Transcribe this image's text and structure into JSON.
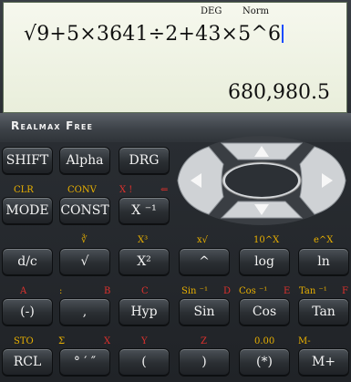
{
  "display": {
    "mode_deg": "DEG",
    "mode_norm": "Norm",
    "expression": "√9+5×3641÷2+43×5^6",
    "result": "680,980.5"
  },
  "app": {
    "name": "Realmax Free"
  },
  "rows": [
    {
      "keys": [
        {
          "id": "shift",
          "label": "SHIFT"
        },
        {
          "id": "alpha",
          "label": "Alpha"
        },
        {
          "id": "drg",
          "label": "DRG"
        }
      ]
    },
    {
      "keys": [
        {
          "id": "mode",
          "label": "MODE",
          "sub_y": "CLR"
        },
        {
          "id": "const",
          "label": "CONST",
          "sub_y": "CONV"
        },
        {
          "id": "recip",
          "label": "X ⁻¹",
          "sub_y": "X !",
          "sub_r": "⇐"
        }
      ]
    },
    {
      "keys": [
        {
          "id": "dc",
          "label": "d/c"
        },
        {
          "id": "sqrt",
          "label": "√",
          "sub_y": "∛"
        },
        {
          "id": "sq",
          "label": "X²",
          "sub_y": "X³"
        },
        {
          "id": "pow",
          "label": "^",
          "sub_y": "x√"
        },
        {
          "id": "log",
          "label": "log",
          "sub_y": "10^X"
        },
        {
          "id": "ln",
          "label": "ln",
          "sub_y": "e^X"
        }
      ]
    },
    {
      "keys": [
        {
          "id": "neg",
          "label": "(-)",
          "sub_r": "A"
        },
        {
          "id": "comma",
          "label": ",",
          "sub_y": ":",
          "sub_r": "B"
        },
        {
          "id": "hyp",
          "label": "Hyp",
          "sub_r": "C"
        },
        {
          "id": "sin",
          "label": "Sin",
          "sub_y": "Sin ⁻¹",
          "sub_r": "D"
        },
        {
          "id": "cos",
          "label": "Cos",
          "sub_y": "Cos ⁻¹",
          "sub_r": "E"
        },
        {
          "id": "tan",
          "label": "Tan",
          "sub_y": "Tan ⁻¹",
          "sub_r": "F"
        }
      ]
    },
    {
      "keys": [
        {
          "id": "rcl",
          "label": "RCL",
          "sub_y": "STO"
        },
        {
          "id": "dms",
          "label": "° ′ ″",
          "sub_y": "Σ",
          "sub_r": "X"
        },
        {
          "id": "lparen",
          "label": "(",
          "sub_r": "Y"
        },
        {
          "id": "rparen",
          "label": ")",
          "sub_r": "Z"
        },
        {
          "id": "paren_star",
          "label": "(*)",
          "sub_y": "0.00"
        },
        {
          "id": "mplus",
          "label": "M+",
          "sub_y": "M-"
        }
      ]
    }
  ],
  "nav": {
    "up": "up",
    "down": "down",
    "left": "left",
    "right": "right"
  }
}
